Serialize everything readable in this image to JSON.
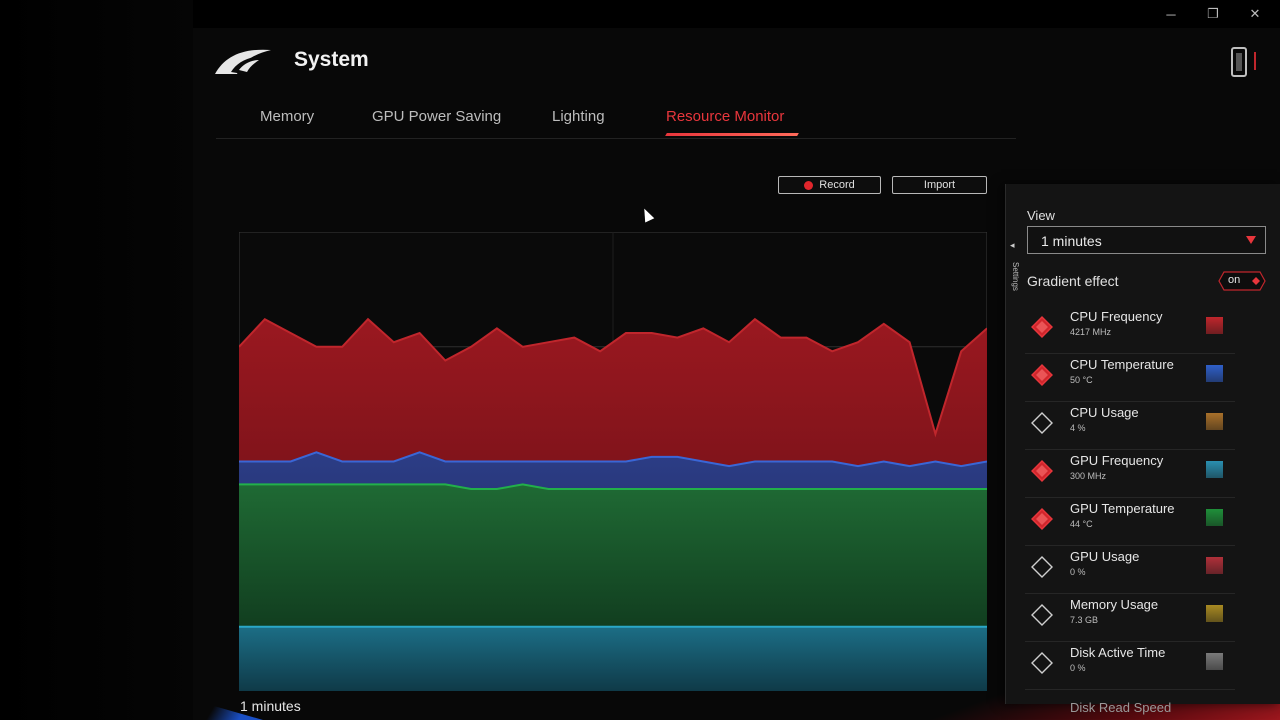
{
  "app": {
    "title": "System",
    "logo": "rog-eye-logo"
  },
  "window_controls": {
    "minimize": "─",
    "restore": "❐",
    "close": "✕"
  },
  "tabs": [
    {
      "label": "Memory",
      "active": false
    },
    {
      "label": "GPU Power Saving",
      "active": false
    },
    {
      "label": "Lighting",
      "active": false
    },
    {
      "label": "Resource Monitor",
      "active": true
    }
  ],
  "toolbar": {
    "record_label": "Record",
    "import_label": "Import"
  },
  "chart_footer": {
    "range_label": "1 minutes"
  },
  "settings_panel": {
    "tab_label": "Settings",
    "view_label": "View",
    "view_value": "1  minutes",
    "gradient_label": "Gradient effect",
    "gradient_state": "on",
    "metrics": [
      {
        "name": "CPU Frequency",
        "value": "4217 MHz",
        "enabled": true,
        "color": "#c0262c"
      },
      {
        "name": "CPU Temperature",
        "value": "50 °C",
        "enabled": true,
        "color": "#2f5fc9"
      },
      {
        "name": "CPU Usage",
        "value": "4 %",
        "enabled": false,
        "color": "#a8702a"
      },
      {
        "name": "GPU Frequency",
        "value": "300 MHz",
        "enabled": true,
        "color": "#2a8fb0"
      },
      {
        "name": "GPU Temperature",
        "value": "44 °C",
        "enabled": true,
        "color": "#1f8f3a"
      },
      {
        "name": "GPU Usage",
        "value": "0 %",
        "enabled": false,
        "color": "#b0303a"
      },
      {
        "name": "Memory Usage",
        "value": "7.3 GB",
        "enabled": false,
        "color": "#a88a22"
      },
      {
        "name": "Disk Active Time",
        "value": "0 %",
        "enabled": false,
        "color": "#7a7a7a"
      }
    ],
    "partial_item": "Disk Read Speed"
  },
  "chart_data": {
    "type": "area",
    "x_range": [
      0,
      30
    ],
    "ylim": [
      0,
      100
    ],
    "grid": true,
    "series": [
      {
        "name": "CPU Frequency",
        "color": "#c0262c",
        "values": [
          75,
          81,
          78,
          75,
          75,
          81,
          76,
          78,
          72,
          75,
          79,
          75,
          76,
          77,
          74,
          78,
          78,
          77,
          79,
          76,
          81,
          77,
          77,
          74,
          76,
          80,
          76,
          56,
          74,
          79
        ]
      },
      {
        "name": "CPU Temperature",
        "color": "#3a66d6",
        "values": [
          50,
          50,
          50,
          52,
          50,
          50,
          50,
          52,
          50,
          50,
          50,
          50,
          50,
          50,
          50,
          50,
          51,
          51,
          50,
          49,
          50,
          50,
          50,
          50,
          49,
          50,
          49,
          50,
          49,
          50
        ]
      },
      {
        "name": "GPU Temperature",
        "color": "#22b04a",
        "values": [
          45,
          45,
          45,
          45,
          45,
          45,
          45,
          45,
          45,
          44,
          44,
          45,
          44,
          44,
          44,
          44,
          44,
          44,
          44,
          44,
          44,
          44,
          44,
          44,
          44,
          44,
          44,
          44,
          44,
          44
        ]
      },
      {
        "name": "GPU Frequency",
        "color": "#2aa8c8",
        "values": [
          14,
          14,
          14,
          14,
          14,
          14,
          14,
          14,
          14,
          14,
          14,
          14,
          14,
          14,
          14,
          14,
          14,
          14,
          14,
          14,
          14,
          14,
          14,
          14,
          14,
          14,
          14,
          14,
          14,
          14
        ]
      }
    ]
  }
}
